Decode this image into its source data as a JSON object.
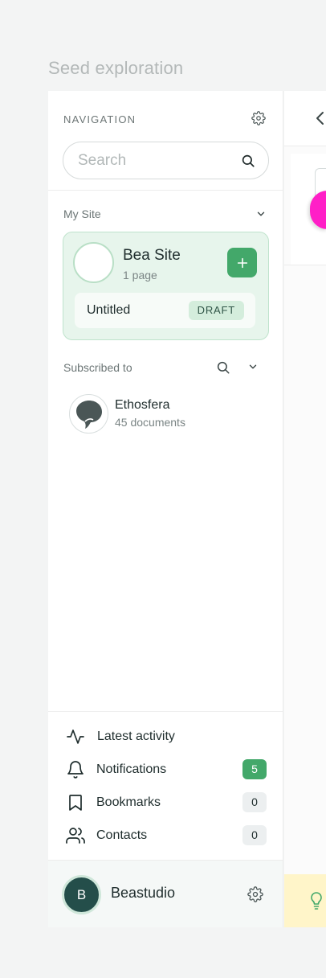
{
  "page": {
    "title": "Seed exploration"
  },
  "nav": {
    "title": "NAVIGATION",
    "search": {
      "placeholder": "Search",
      "value": ""
    }
  },
  "my_site": {
    "label": "My Site",
    "site": {
      "name": "Bea Site",
      "meta": "1 page"
    },
    "page": {
      "title": "Untitled",
      "status": "DRAFT"
    }
  },
  "subscribed": {
    "label": "Subscribed to",
    "items": [
      {
        "name": "Ethosfera",
        "meta": "45 documents"
      }
    ]
  },
  "bottom_nav": [
    {
      "label": "Latest activity",
      "icon": "activity-icon"
    },
    {
      "label": "Notifications",
      "icon": "bell-icon",
      "count": "5"
    },
    {
      "label": "Bookmarks",
      "icon": "bookmark-icon",
      "count": "0"
    },
    {
      "label": "Contacts",
      "icon": "contacts-icon",
      "count": "0"
    }
  ],
  "user": {
    "initial": "B",
    "name": "Beastudio"
  },
  "colors": {
    "accent": "#43a86a",
    "card_bg": "#e7f5ec",
    "avatar_bg": "#244e4a",
    "pink": "#ff1fc7",
    "tip_bg": "#fff5c9"
  }
}
